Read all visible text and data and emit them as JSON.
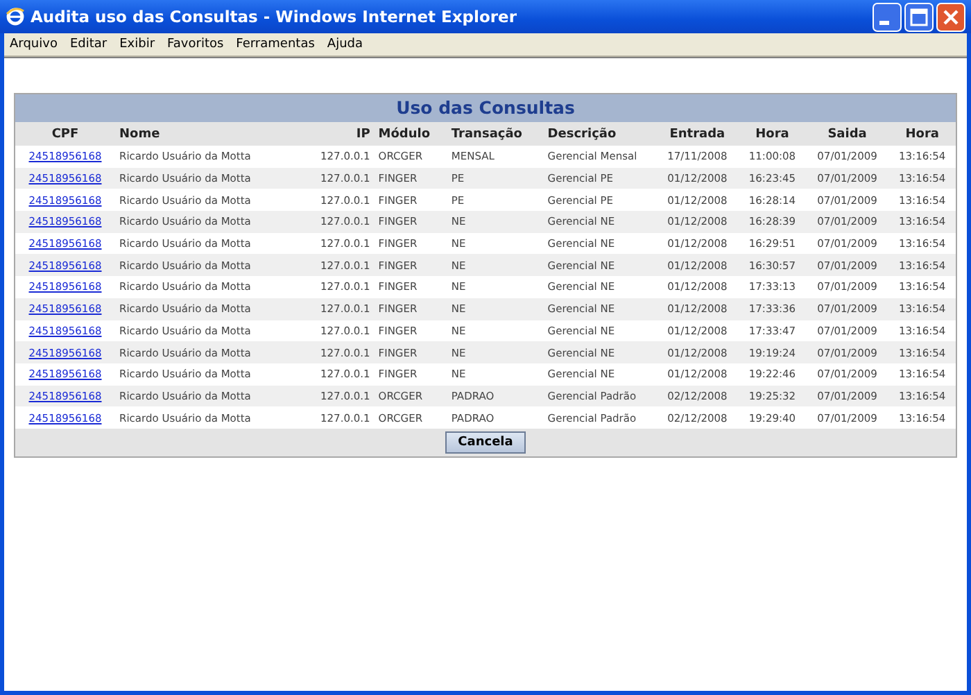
{
  "window": {
    "title": "Audita uso das Consultas - Windows Internet Explorer"
  },
  "menu": [
    "Arquivo",
    "Editar",
    "Exibir",
    "Favoritos",
    "Ferramentas",
    "Ajuda"
  ],
  "panel": {
    "title": "Uso das Consultas",
    "columns": [
      "CPF",
      "Nome",
      "IP",
      "Módulo",
      "Transação",
      "Descrição",
      "Entrada",
      "Hora",
      "Saida",
      "Hora"
    ],
    "rows": [
      [
        "24518956168",
        "Ricardo Usuário da Motta",
        "127.0.0.1",
        "ORCGER",
        "MENSAL",
        "Gerencial Mensal",
        "17/11/2008",
        "11:00:08",
        "07/01/2009",
        "13:16:54"
      ],
      [
        "24518956168",
        "Ricardo Usuário da Motta",
        "127.0.0.1",
        "FINGER",
        "PE",
        "Gerencial PE",
        "01/12/2008",
        "16:23:45",
        "07/01/2009",
        "13:16:54"
      ],
      [
        "24518956168",
        "Ricardo Usuário da Motta",
        "127.0.0.1",
        "FINGER",
        "PE",
        "Gerencial PE",
        "01/12/2008",
        "16:28:14",
        "07/01/2009",
        "13:16:54"
      ],
      [
        "24518956168",
        "Ricardo Usuário da Motta",
        "127.0.0.1",
        "FINGER",
        "NE",
        "Gerencial NE",
        "01/12/2008",
        "16:28:39",
        "07/01/2009",
        "13:16:54"
      ],
      [
        "24518956168",
        "Ricardo Usuário da Motta",
        "127.0.0.1",
        "FINGER",
        "NE",
        "Gerencial NE",
        "01/12/2008",
        "16:29:51",
        "07/01/2009",
        "13:16:54"
      ],
      [
        "24518956168",
        "Ricardo Usuário da Motta",
        "127.0.0.1",
        "FINGER",
        "NE",
        "Gerencial NE",
        "01/12/2008",
        "16:30:57",
        "07/01/2009",
        "13:16:54"
      ],
      [
        "24518956168",
        "Ricardo Usuário da Motta",
        "127.0.0.1",
        "FINGER",
        "NE",
        "Gerencial NE",
        "01/12/2008",
        "17:33:13",
        "07/01/2009",
        "13:16:54"
      ],
      [
        "24518956168",
        "Ricardo Usuário da Motta",
        "127.0.0.1",
        "FINGER",
        "NE",
        "Gerencial NE",
        "01/12/2008",
        "17:33:36",
        "07/01/2009",
        "13:16:54"
      ],
      [
        "24518956168",
        "Ricardo Usuário da Motta",
        "127.0.0.1",
        "FINGER",
        "NE",
        "Gerencial NE",
        "01/12/2008",
        "17:33:47",
        "07/01/2009",
        "13:16:54"
      ],
      [
        "24518956168",
        "Ricardo Usuário da Motta",
        "127.0.0.1",
        "FINGER",
        "NE",
        "Gerencial NE",
        "01/12/2008",
        "19:19:24",
        "07/01/2009",
        "13:16:54"
      ],
      [
        "24518956168",
        "Ricardo Usuário da Motta",
        "127.0.0.1",
        "FINGER",
        "NE",
        "Gerencial NE",
        "01/12/2008",
        "19:22:46",
        "07/01/2009",
        "13:16:54"
      ],
      [
        "24518956168",
        "Ricardo Usuário da Motta",
        "127.0.0.1",
        "ORCGER",
        "PADRAO",
        "Gerencial Padrão",
        "02/12/2008",
        "19:25:32",
        "07/01/2009",
        "13:16:54"
      ],
      [
        "24518956168",
        "Ricardo Usuário da Motta",
        "127.0.0.1",
        "ORCGER",
        "PADRAO",
        "Gerencial Padrão",
        "02/12/2008",
        "19:29:40",
        "07/01/2009",
        "13:16:54"
      ]
    ],
    "button": "Cancela"
  }
}
